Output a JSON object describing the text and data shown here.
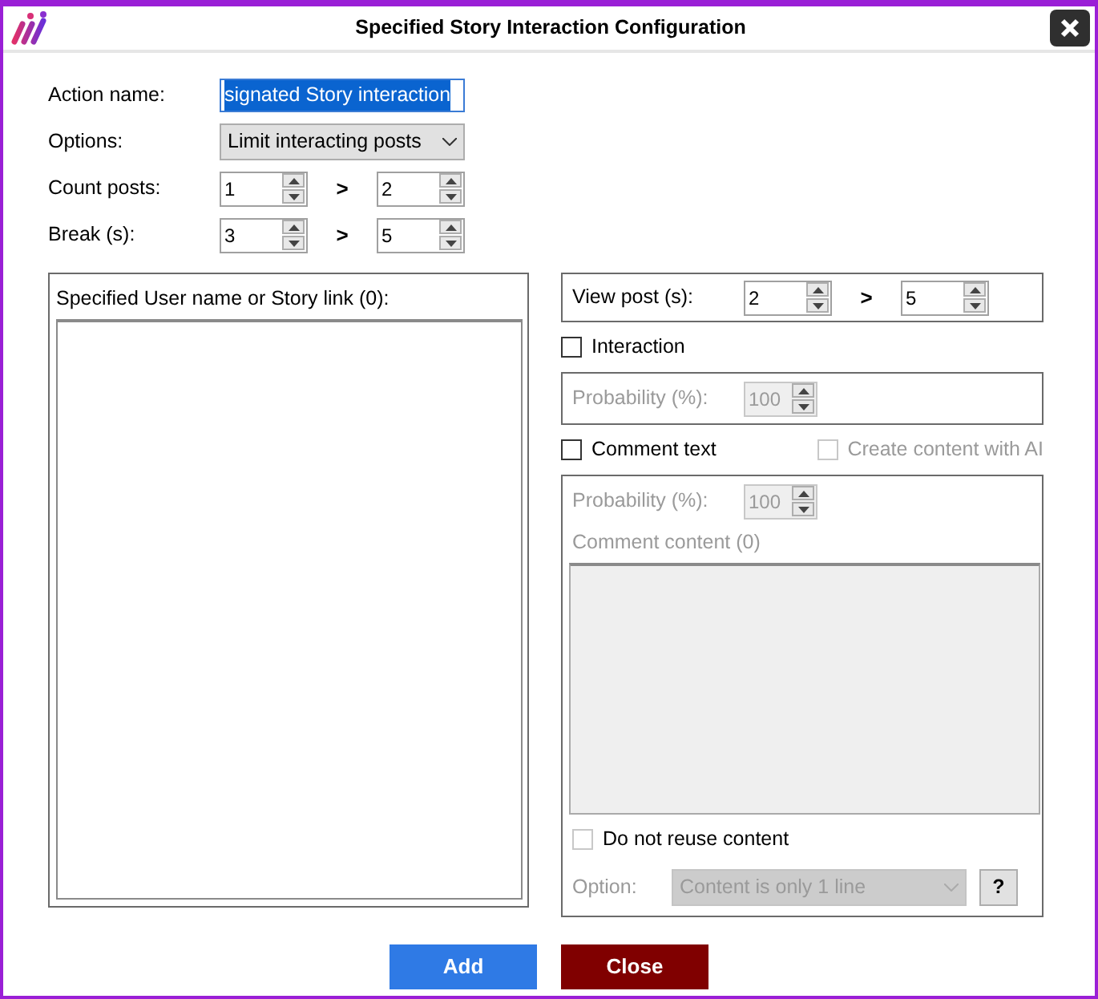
{
  "window": {
    "title": "Specified Story Interaction Configuration"
  },
  "action_name": {
    "label": "Action name:",
    "value": "signated Story interaction",
    "selected": true
  },
  "options": {
    "label": "Options:",
    "value": "Limit interacting posts"
  },
  "count_posts": {
    "label": "Count posts:",
    "from": "1",
    "separator": ">",
    "to": "2"
  },
  "break": {
    "label": "Break (s):",
    "from": "3",
    "separator": ">",
    "to": "5"
  },
  "user_list": {
    "label": "Specified User name or Story link (0):"
  },
  "view_post": {
    "label": "View post (s):",
    "from": "2",
    "separator": ">",
    "to": "5"
  },
  "interaction": {
    "label": "Interaction",
    "checked": false
  },
  "interaction_probability": {
    "label": "Probability (%):",
    "value": "100",
    "disabled": true
  },
  "comment_text": {
    "label": "Comment text",
    "checked": false
  },
  "ai_content": {
    "label": "Create content with AI",
    "checked": false,
    "disabled": true
  },
  "comment_probability": {
    "label": "Probability (%):",
    "value": "100",
    "disabled": true
  },
  "comment_content": {
    "label": "Comment content (0)",
    "disabled": true
  },
  "no_reuse": {
    "label": "Do not reuse content",
    "checked": false,
    "disabled": true
  },
  "option": {
    "label": "Option:",
    "value": "Content is only 1 line",
    "help": "?",
    "disabled": true
  },
  "buttons": [
    {
      "label": "Add",
      "kind": "primary"
    },
    {
      "label": "Close",
      "kind": "danger"
    }
  ]
}
